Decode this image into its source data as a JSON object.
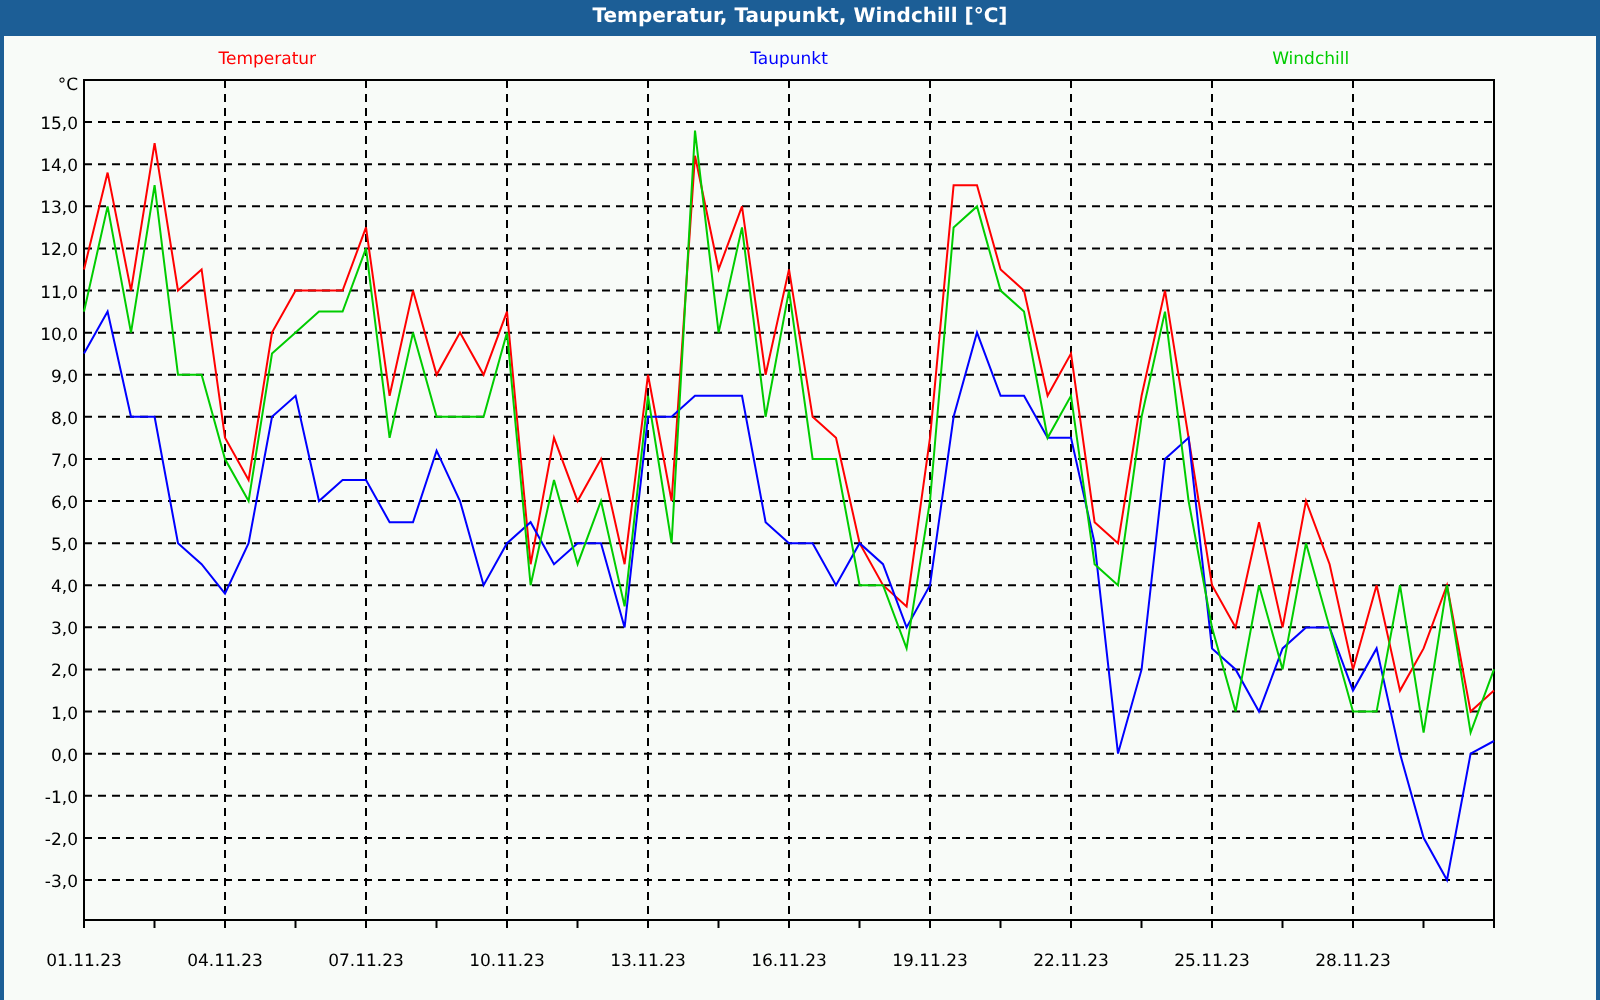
{
  "window": {
    "title": "Temperatur, Taupunkt, Windchill [°C]"
  },
  "chart": {
    "chart_data": {
      "type": "line",
      "ylabel": "°C",
      "categories": [
        "01.11.23",
        null,
        null,
        null,
        null,
        null,
        "04.11.23",
        null,
        null,
        null,
        null,
        null,
        "07.11.23",
        null,
        null,
        null,
        null,
        null,
        "10.11.23",
        null,
        null,
        null,
        null,
        null,
        "13.11.23",
        null,
        null,
        null,
        null,
        null,
        "16.11.23",
        null,
        null,
        null,
        null,
        null,
        "19.11.23",
        null,
        null,
        null,
        null,
        null,
        "22.11.23",
        null,
        null,
        null,
        null,
        null,
        "25.11.23",
        null,
        null,
        null,
        null,
        null,
        "28.11.23",
        null,
        null,
        null,
        null,
        null,
        null
      ],
      "series": [
        {
          "name": "Temperatur",
          "color": "#ff0000",
          "values": [
            11.5,
            13.8,
            11,
            14.5,
            11,
            11.5,
            7.5,
            6.5,
            10,
            11,
            11,
            11,
            12.5,
            8.5,
            11,
            9,
            10,
            9,
            10.5,
            4.5,
            7.5,
            6,
            7,
            4.5,
            9,
            6,
            14.2,
            11.5,
            13,
            9,
            11.5,
            8,
            7.5,
            5,
            4,
            3.5,
            7.5,
            13.5,
            13.5,
            11.5,
            11,
            8.5,
            9.5,
            5.5,
            5,
            8.5,
            11,
            7.5,
            4,
            3,
            5.5,
            3,
            6,
            4.5,
            2,
            4,
            1.5,
            2.5,
            4,
            1,
            1.5
          ]
        },
        {
          "name": "Taupunkt",
          "color": "#0000ff",
          "values": [
            9.5,
            10.5,
            8,
            8,
            5,
            4.5,
            3.8,
            5,
            8,
            8.5,
            6,
            6.5,
            6.5,
            5.5,
            5.5,
            7.2,
            6,
            4,
            5,
            5.5,
            4.5,
            5,
            5,
            3,
            8,
            8,
            8.5,
            8.5,
            8.5,
            5.5,
            5,
            5,
            4,
            5,
            4.5,
            3,
            4,
            8,
            10,
            8.5,
            8.5,
            7.5,
            7.5,
            5,
            0,
            2,
            7,
            7.5,
            2.5,
            2,
            1,
            2.5,
            3,
            3,
            1.5,
            2.5,
            0,
            -2,
            -3,
            0,
            0.3
          ]
        },
        {
          "name": "Windchill",
          "color": "#00cc00",
          "values": [
            10.5,
            13,
            10,
            13.5,
            9,
            9,
            7,
            6,
            9.5,
            10,
            10.5,
            10.5,
            12,
            7.5,
            10,
            8,
            8,
            8,
            10,
            4,
            6.5,
            4.5,
            6,
            3.5,
            8.5,
            5,
            14.8,
            10,
            12.5,
            8,
            11,
            7,
            7,
            4,
            4,
            2.5,
            6,
            12.5,
            13,
            11,
            10.5,
            7.5,
            8.5,
            4.5,
            4,
            8,
            10.5,
            6,
            3,
            1,
            4,
            2,
            5,
            3,
            1,
            1,
            4,
            0.5,
            4,
            0.5,
            2
          ]
        }
      ],
      "grid": true,
      "ylim": [
        -3.95,
        16
      ],
      "yticks": [
        {
          "value": 15,
          "label": "15,0"
        },
        {
          "value": 14,
          "label": "14,0"
        },
        {
          "value": 13,
          "label": "13,0"
        },
        {
          "value": 12,
          "label": "12,0"
        },
        {
          "value": 11,
          "label": "11,0"
        },
        {
          "value": 10,
          "label": "10,0"
        },
        {
          "value": 9,
          "label": "9,0"
        },
        {
          "value": 8,
          "label": "8,0"
        },
        {
          "value": 7,
          "label": "7,0"
        },
        {
          "value": 6,
          "label": "6,0"
        },
        {
          "value": 5,
          "label": "5,0"
        },
        {
          "value": 4,
          "label": "4,0"
        },
        {
          "value": 3,
          "label": "3,0"
        },
        {
          "value": 2,
          "label": "2,0"
        },
        {
          "value": 1,
          "label": "1,0"
        },
        {
          "value": 0,
          "label": "0,0"
        },
        {
          "value": -1,
          "label": "-1,0"
        },
        {
          "value": -2,
          "label": "-2,0"
        },
        {
          "value": -3,
          "label": "-3,0"
        }
      ]
    }
  }
}
